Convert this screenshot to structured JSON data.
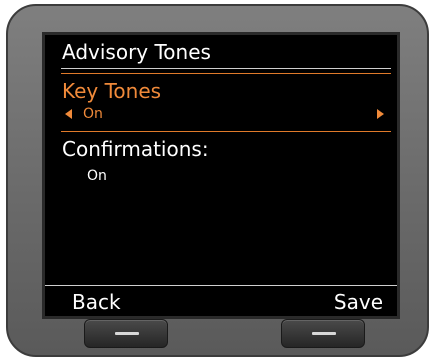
{
  "screen": {
    "title": "Advisory Tones",
    "items": [
      {
        "label": "Key Tones",
        "value": "On",
        "selected": true
      },
      {
        "label": "Confirmations:",
        "value": "On",
        "selected": false
      }
    ]
  },
  "softkeys": {
    "left_label": "Back",
    "right_label": "Save"
  },
  "icons": {
    "value_prev": "triangle-left-icon",
    "value_next": "triangle-right-icon",
    "hw_button_symbol": "dash-icon"
  },
  "colors": {
    "accent": "#f08a3a",
    "screen_bg": "#000000",
    "text": "#ffffff",
    "bezel": "#6f6f6f"
  }
}
